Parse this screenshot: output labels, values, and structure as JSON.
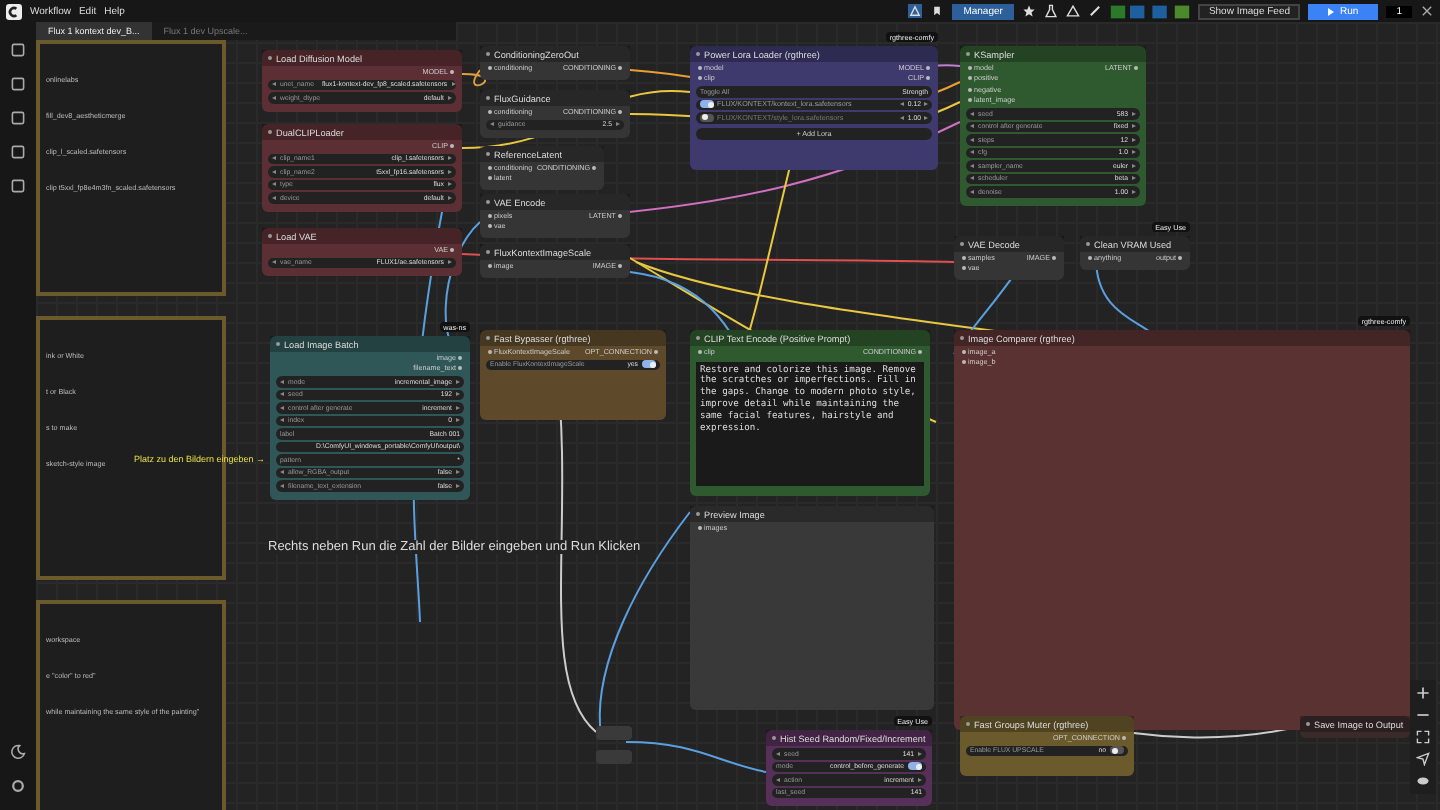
{
  "menu": [
    "Workflow",
    "Edit",
    "Help"
  ],
  "toolbar": {
    "manager": "Manager",
    "image_feed": "Show Image Feed",
    "run": "Run",
    "batch_count": "1"
  },
  "tabs": [
    {
      "label": "Flux 1 kontext dev_B...",
      "selected": true
    },
    {
      "label": "Flux 1 dev Upscale...",
      "selected": false
    }
  ],
  "notes": [
    {
      "lines": [
        "onlinelabs",
        "fill_dev8_aestheticmerge",
        "clip_l_scaled.safetensors",
        "clip t5xxl_fp8e4m3fn_scaled.safetensors"
      ]
    },
    {
      "lines": [
        "ink or White",
        "t or Black",
        "s to make",
        "sketch-style image"
      ]
    },
    {
      "lines": [
        "workspace",
        "e \"color\" to red\"",
        "while maintaining the same style of the painting\""
      ]
    }
  ],
  "hint": "Platz zu den Bildern eingeben →",
  "instruction": "Rechts neben Run die Zahl der Bilder eingeben und Run Klicken",
  "nodes": [
    {
      "title": "Load Diffusion Model",
      "color": "#5c2f35",
      "outputs": [
        "MODEL"
      ],
      "widgets": [
        {
          "kind": "value",
          "label": "unet_name",
          "value": "flux1-kontext-dev_fp8_scaled.safetensors"
        },
        {
          "kind": "value",
          "label": "weight_dtype",
          "value": "default"
        }
      ]
    },
    {
      "title": "DualCLIPLoader",
      "color": "#5c2f35",
      "outputs": [
        "CLIP"
      ],
      "widgets": [
        {
          "kind": "value",
          "label": "clip_name1",
          "value": "clip_l.safetensors"
        },
        {
          "kind": "value",
          "label": "clip_name2",
          "value": "t5xxl_fp16.safetensors"
        },
        {
          "kind": "value",
          "label": "type",
          "value": "flux"
        },
        {
          "kind": "value",
          "label": "device",
          "value": "default"
        }
      ]
    },
    {
      "title": "Load VAE",
      "color": "#5c2f35",
      "outputs": [
        "VAE"
      ],
      "widgets": [
        {
          "kind": "value",
          "label": "vae_name",
          "value": "FLUX1/ae.safetensors"
        }
      ]
    },
    {
      "title": "Load Image Batch",
      "color": "#2f5757",
      "badge": "was-ns",
      "outputs": [
        "image",
        "filename_text"
      ],
      "widgets": [
        {
          "kind": "value",
          "label": "mode",
          "value": "incremental_image"
        },
        {
          "kind": "value",
          "label": "seed",
          "value": "192"
        },
        {
          "kind": "value",
          "label": "control after generate",
          "value": "increment"
        },
        {
          "kind": "value",
          "label": "index",
          "value": "0"
        },
        {
          "kind": "text",
          "label": "label",
          "value": "Batch 001"
        },
        {
          "kind": "text",
          "value": "D:\\ComfyUI_windows_portable\\ComfyUI\\output\\"
        },
        {
          "kind": "text",
          "label": "pattern",
          "value": "*"
        },
        {
          "kind": "value",
          "label": "allow_RGBA_output",
          "value": "false"
        },
        {
          "kind": "value",
          "label": "filename_text_extension",
          "value": "false"
        }
      ]
    },
    {
      "title": "ConditioningZeroOut",
      "color": "#353535",
      "inputs": [
        "conditioning"
      ],
      "outputs": [
        "CONDITIONING"
      ]
    },
    {
      "title": "FluxGuidance",
      "color": "#353535",
      "inputs": [
        "conditioning"
      ],
      "outputs": [
        "CONDITIONING"
      ],
      "widgets": [
        {
          "kind": "value",
          "label": "guidance",
          "value": "2.5"
        }
      ]
    },
    {
      "title": "ReferenceLatent",
      "color": "#353535",
      "inputs": [
        "conditioning",
        "latent"
      ],
      "outputs": [
        "CONDITIONING"
      ]
    },
    {
      "title": "VAE Encode",
      "color": "#353535",
      "inputs": [
        "pixels",
        "vae"
      ],
      "outputs": [
        "LATENT"
      ]
    },
    {
      "title": "FluxKontextImageScale",
      "color": "#353535",
      "inputs": [
        "image"
      ],
      "outputs": [
        "IMAGE"
      ]
    },
    {
      "title": "Fast Bypasser (rgthree)",
      "color": "#5e4a2b",
      "inputs": [
        "FluxKontextImageScale"
      ],
      "outputs": [
        "OPT_CONNECTION"
      ],
      "widgets": [
        {
          "kind": "toggle",
          "label": "Enable FluxKontextImageScale",
          "value": "yes",
          "on": true
        }
      ]
    },
    {
      "title": "Power Lora Loader (rgthree)",
      "color": "#3e3a6e",
      "badge": "rgthree-comfy",
      "inputs": [
        "model",
        "clip"
      ],
      "outputs": [
        "MODEL",
        "CLIP"
      ],
      "widgets": [
        {
          "kind": "text",
          "label": "Toggle All",
          "value": "Strength"
        },
        {
          "kind": "lora",
          "label": "FLUX/KONTEXT/kontext_lora.safetensors",
          "value": "0.12",
          "on": true
        },
        {
          "kind": "lora",
          "label": "FLUX/KONTEXT/style_lora.safetensors",
          "value": "1.00",
          "on": false
        },
        {
          "kind": "button",
          "label": "+ Add Lora"
        }
      ]
    },
    {
      "title": "KSampler",
      "color": "#2f5a2f",
      "inputs": [
        "model",
        "positive",
        "negative",
        "latent_image"
      ],
      "outputs": [
        "LATENT"
      ],
      "widgets": [
        {
          "kind": "value",
          "label": "seed",
          "value": "583"
        },
        {
          "kind": "value",
          "label": "control after generate",
          "value": "fixed"
        },
        {
          "kind": "value",
          "label": "steps",
          "value": "12"
        },
        {
          "kind": "value",
          "label": "cfg",
          "value": "1.0"
        },
        {
          "kind": "value",
          "label": "sampler_name",
          "value": "euler"
        },
        {
          "kind": "value",
          "label": "scheduler",
          "value": "beta"
        },
        {
          "kind": "value",
          "label": "denoise",
          "value": "1.00"
        }
      ]
    },
    {
      "title": "VAE Decode",
      "color": "#353535",
      "inputs": [
        "samples",
        "vae"
      ],
      "outputs": [
        "IMAGE"
      ]
    },
    {
      "title": "Clean VRAM Used",
      "color": "#353535",
      "badge": "Easy Use",
      "inputs": [
        "anything"
      ],
      "outputs": [
        "output"
      ]
    },
    {
      "title": "CLIP Text Encode (Positive Prompt)",
      "color": "#2f5a2f",
      "inputs": [
        "clip"
      ],
      "outputs": [
        "CONDITIONING"
      ],
      "widgets": [
        {
          "kind": "prompt",
          "value": "Restore and colorize this image. Remove the scratches or imperfections. Fill in the gaps. Change to modern photo style, improve detail while maintaining the same facial features, hairstyle and expression."
        }
      ]
    },
    {
      "title": "Image Comparer (rgthree)",
      "color": "#5a3232",
      "badge": "rgthree-comfy",
      "inputs": [
        "image_a",
        "image_b"
      ]
    },
    {
      "title": "Preview Image",
      "color": "#393939",
      "inputs": [
        "images"
      ]
    },
    {
      "title": "Hist Seed Random/Fixed/Increment",
      "color": "#57305a",
      "badge": "Easy Use",
      "widgets": [
        {
          "kind": "value",
          "label": "seed",
          "value": "141"
        },
        {
          "kind": "toggle",
          "label": "mode",
          "value": "control_before_generate",
          "on": true
        },
        {
          "kind": "value",
          "label": "action",
          "value": "increment"
        },
        {
          "kind": "text",
          "label": "last_seed",
          "value": "141"
        }
      ]
    },
    {
      "title": "Fast Groups Muter (rgthree)",
      "color": "#6b5a2c",
      "outputs": [
        "OPT_CONNECTION"
      ],
      "widgets": [
        {
          "kind": "toggle",
          "label": "Enable FLUX UPSCALE",
          "value": "no",
          "on": false
        }
      ]
    },
    {
      "title": "Save Image to Output",
      "color": "#3a2a2a"
    }
  ]
}
